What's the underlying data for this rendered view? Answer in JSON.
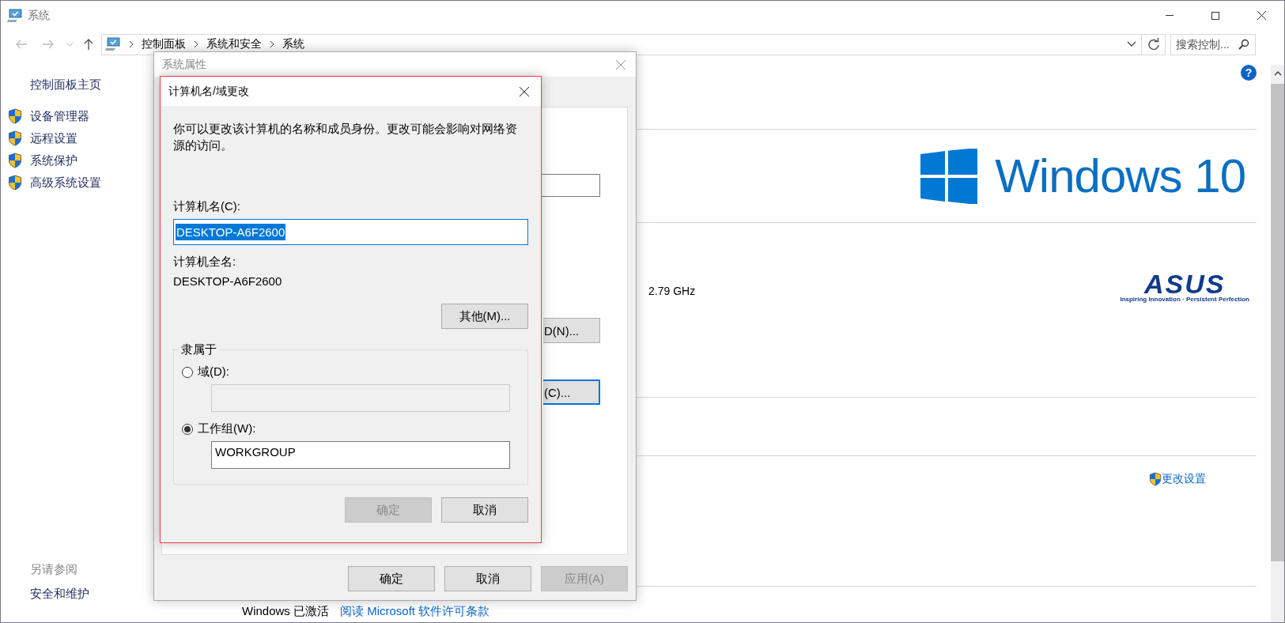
{
  "window": {
    "title": "系统"
  },
  "address_bar": {
    "breadcrumbs": [
      "控制面板",
      "系统和安全",
      "系统"
    ]
  },
  "search": {
    "placeholder": "搜索控制..."
  },
  "help_button": "?",
  "sidebar": {
    "home": "控制面板主页",
    "items": [
      "设备管理器",
      "远程设置",
      "系统保护",
      "高级系统设置"
    ],
    "see_also_title": "另请参阅",
    "see_also": [
      "安全和维护"
    ]
  },
  "content": {
    "logo_text": "Windows 10",
    "cpu_speed": "2.79 GHz",
    "oem_logo": "ASUS",
    "oem_tagline": "Inspiring Innovation · Persistent Perfection",
    "change_settings": "更改设置",
    "activation_status": "Windows 已激活",
    "license_link": "阅读 Microsoft 软件许可条款"
  },
  "system_properties": {
    "title": "系统属性",
    "active": false,
    "partial_buttons": [
      {
        "label": "D(N)...",
        "focused": false
      },
      {
        "label": "(C)...",
        "focused": true
      }
    ],
    "buttons": [
      {
        "label": "确定",
        "disabled": false
      },
      {
        "label": "取消",
        "disabled": false
      },
      {
        "label": "应用(A)",
        "disabled": true
      }
    ]
  },
  "rename_dialog": {
    "title": "计算机名/域更改",
    "description": "你可以更改该计算机的名称和成员身份。更改可能会影响对网络资源的访问。",
    "computer_name_label": "计算机名(C):",
    "computer_name": "DESKTOP-A6F2600",
    "computer_name_selected": true,
    "full_name_label": "计算机全名:",
    "full_name": "DESKTOP-A6F2600",
    "more_button": "其他(M)...",
    "member_of": {
      "title": "隶属于",
      "options": [
        {
          "label": "域(D):",
          "selected": false,
          "disabled": true
        },
        {
          "label": "工作组(W):",
          "selected": true,
          "disabled": false,
          "value": "WORKGROUP"
        }
      ]
    },
    "buttons": [
      {
        "label": "确定",
        "disabled": true
      },
      {
        "label": "取消",
        "disabled": false
      }
    ]
  }
}
